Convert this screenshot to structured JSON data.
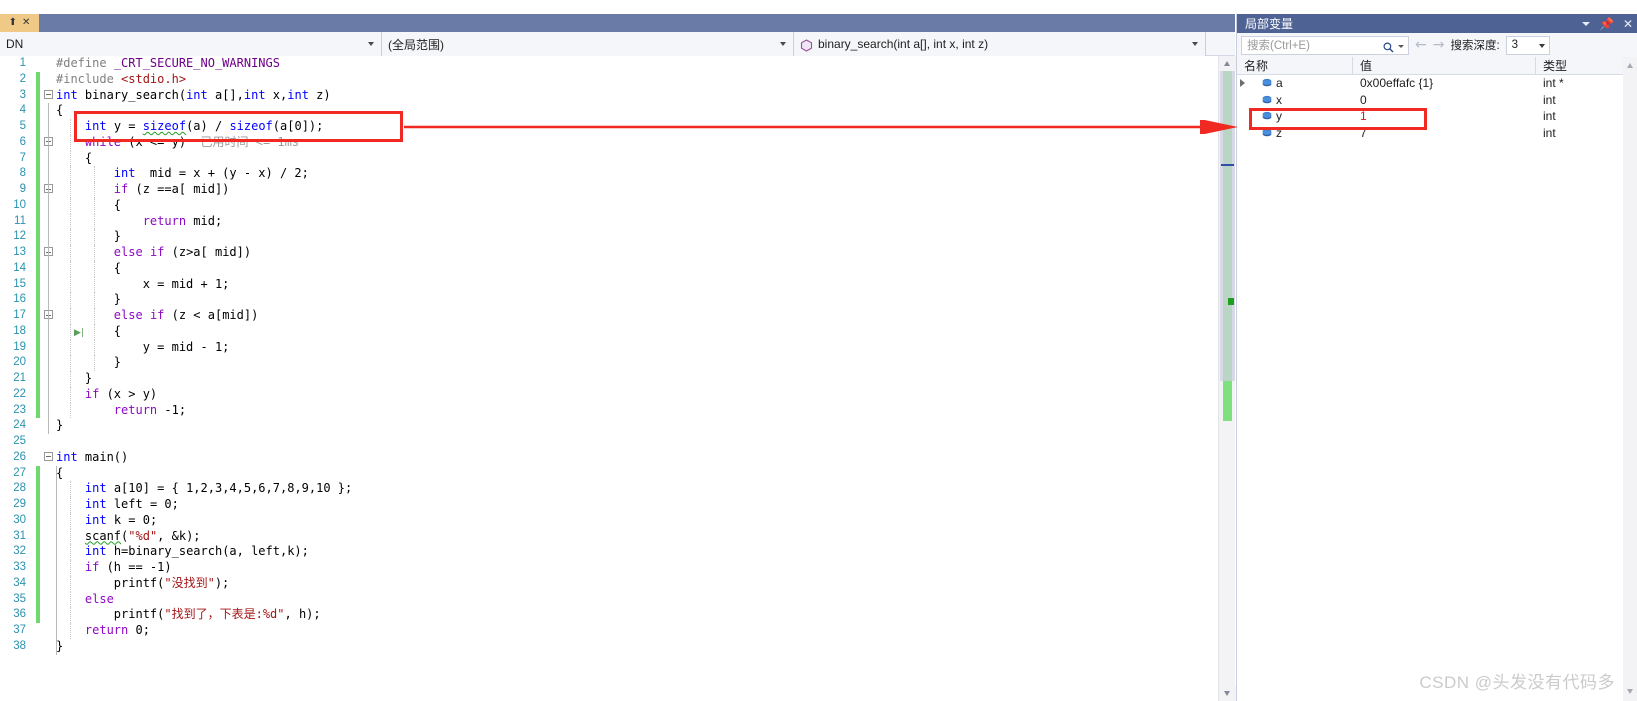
{
  "window": {
    "tab": {
      "pin_icon": "pin-icon",
      "close_icon": "close-icon"
    }
  },
  "editor_toolbar": {
    "project_combo": "DN",
    "scope_combo": "(全局范围)",
    "member_combo": "binary_search(int a[], int x, int z)",
    "member_icon": "method-icon"
  },
  "locals": {
    "title": "局部变量",
    "search_placeholder": "搜索(Ctrl+E)",
    "depth_label": "搜索深度:",
    "depth_value": "3",
    "columns": [
      "名称",
      "值",
      "类型"
    ],
    "rows": [
      {
        "name": "a",
        "value": "0x00effafc {1}",
        "type": "int *",
        "expandable": true,
        "changed": false
      },
      {
        "name": "x",
        "value": "0",
        "type": "int",
        "expandable": false,
        "changed": false
      },
      {
        "name": "y",
        "value": "1",
        "type": "int",
        "expandable": false,
        "changed": true
      },
      {
        "name": "z",
        "value": "7",
        "type": "int",
        "expandable": false,
        "changed": false
      }
    ]
  },
  "code": {
    "language": "c",
    "inline_hint": "已用时间 <= 1ms",
    "lines": [
      {
        "n": "1",
        "text": "#define _CRT_SECURE_NO_WARNINGS"
      },
      {
        "n": "2",
        "text": "#include <stdio.h>"
      },
      {
        "n": "3",
        "text": "int binary_search(int a[],int x,int z)"
      },
      {
        "n": "4",
        "text": "{"
      },
      {
        "n": "5",
        "text": "    int y = sizeof(a) / sizeof(a[0]);"
      },
      {
        "n": "6",
        "text": "    while (x <= y)"
      },
      {
        "n": "7",
        "text": "    {"
      },
      {
        "n": "8",
        "text": "        int  mid = x + (y - x) / 2;"
      },
      {
        "n": "9",
        "text": "        if (z ==a[ mid])"
      },
      {
        "n": "10",
        "text": "        {"
      },
      {
        "n": "11",
        "text": "            return mid;"
      },
      {
        "n": "12",
        "text": "        }"
      },
      {
        "n": "13",
        "text": "        else if (z>a[ mid])"
      },
      {
        "n": "14",
        "text": "        {"
      },
      {
        "n": "15",
        "text": "            x = mid + 1;"
      },
      {
        "n": "16",
        "text": "        }"
      },
      {
        "n": "17",
        "text": "        else if (z < a[mid])"
      },
      {
        "n": "18",
        "text": "        {"
      },
      {
        "n": "19",
        "text": "            y = mid - 1;"
      },
      {
        "n": "20",
        "text": "        }"
      },
      {
        "n": "21",
        "text": "    }"
      },
      {
        "n": "22",
        "text": "    if (x > y)"
      },
      {
        "n": "23",
        "text": "        return -1;"
      },
      {
        "n": "24",
        "text": "}"
      },
      {
        "n": "25",
        "text": ""
      },
      {
        "n": "26",
        "text": "int main()"
      },
      {
        "n": "27",
        "text": "{"
      },
      {
        "n": "28",
        "text": "    int a[10] = { 1,2,3,4,5,6,7,8,9,10 };"
      },
      {
        "n": "29",
        "text": "    int left = 0;"
      },
      {
        "n": "30",
        "text": "    int k = 0;"
      },
      {
        "n": "31",
        "text": "    scanf(\"%d\", &k);"
      },
      {
        "n": "32",
        "text": "    int h=binary_search(a, left,k);"
      },
      {
        "n": "33",
        "text": "    if (h == -1)"
      },
      {
        "n": "34",
        "text": "        printf(\"没找到\");"
      },
      {
        "n": "35",
        "text": "    else"
      },
      {
        "n": "36",
        "text": "        printf(\"找到了，下表是:%d\", h);"
      },
      {
        "n": "37",
        "text": "    return 0;"
      },
      {
        "n": "38",
        "text": "}"
      }
    ]
  },
  "annotations": {
    "highlight_color": "#f02a22",
    "code_box_target": "int y = sizeof(a) / sizeof(a[0]);",
    "var_box_target": "y"
  },
  "watermark": "CSDN @头发没有代码多"
}
